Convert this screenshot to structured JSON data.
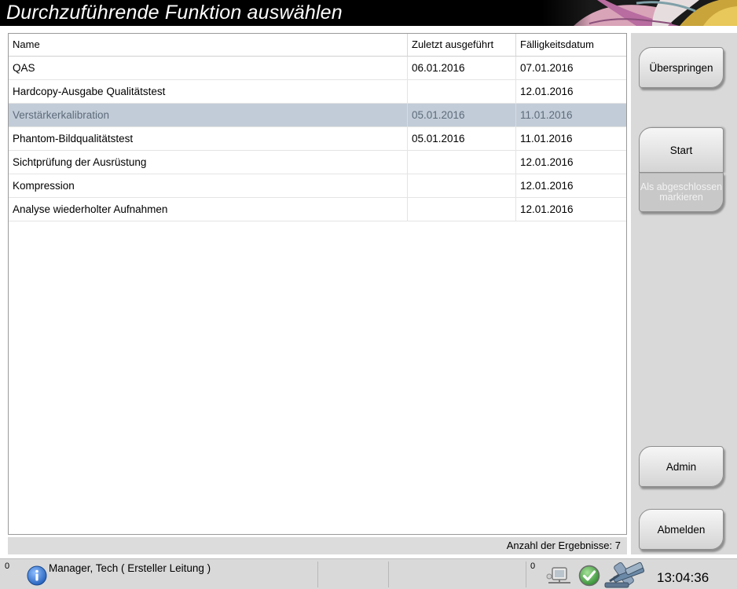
{
  "header": {
    "title": "Durchzuführende Funktion auswählen"
  },
  "table": {
    "columns": [
      "Name",
      "Zuletzt ausgeführt",
      "Fälligkeitsdatum"
    ],
    "rows": [
      {
        "name": "QAS",
        "last": "06.01.2016",
        "due": "07.01.2016",
        "selected": false
      },
      {
        "name": "Hardcopy-Ausgabe Qualitätstest",
        "last": "",
        "due": "12.01.2016",
        "selected": false
      },
      {
        "name": "Verstärkerkalibration",
        "last": "05.01.2016",
        "due": "11.01.2016",
        "selected": true
      },
      {
        "name": "Phantom-Bildqualitätstest",
        "last": "05.01.2016",
        "due": "11.01.2016",
        "selected": false
      },
      {
        "name": "Sichtprüfung der Ausrüstung",
        "last": "",
        "due": "12.01.2016",
        "selected": false
      },
      {
        "name": "Kompression",
        "last": "",
        "due": "12.01.2016",
        "selected": false
      },
      {
        "name": "Analyse wiederholter Aufnahmen",
        "last": "",
        "due": "12.01.2016",
        "selected": false
      }
    ],
    "results_label": "Anzahl der Ergebnisse: 7"
  },
  "buttons": {
    "skip": "Überspringen",
    "start": "Start",
    "mark_complete": "Als abgeschlossen markieren",
    "admin": "Admin",
    "logout": "Abmelden"
  },
  "statusbar": {
    "left_count": "0",
    "user": "Manager, Tech ( Ersteller Leitung )",
    "right_count": "0",
    "time": "13:04:36",
    "icons": [
      "info-icon",
      "network-icon",
      "check-ok-icon",
      "gantry-icon"
    ]
  },
  "colors": {
    "selected_row": "#c2ccd8",
    "panel": "#d9d9d9",
    "header_bg": "#000000",
    "ok_green": "#3aa83a",
    "info_blue": "#2a6bc4"
  }
}
